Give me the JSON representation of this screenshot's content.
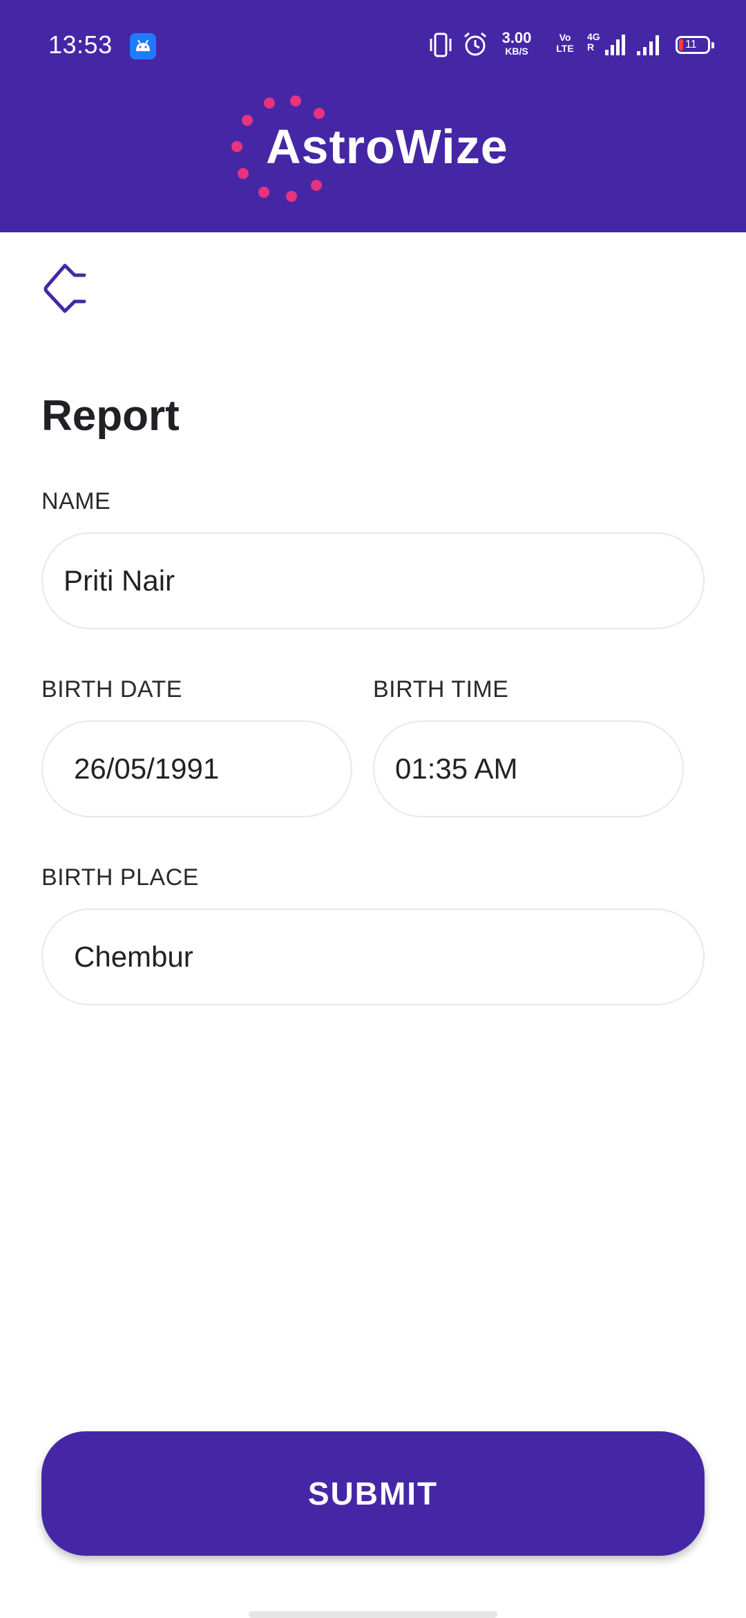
{
  "status_bar": {
    "time": "13:53",
    "speed_value": "3.00",
    "speed_unit": "KB/S",
    "volte_line1": "Vo",
    "volte_line2": "LTE",
    "network_line1": "4G",
    "network_line2": "R",
    "battery": "11"
  },
  "header": {
    "logo_text": "AstroWize",
    "color": "#4527a6",
    "logo_dots_color": "#e8337e"
  },
  "page": {
    "title": "Report"
  },
  "form": {
    "name_label": "NAME",
    "name_value": "Priti Nair",
    "birth_date_label": "BIRTH DATE",
    "birth_date_value": "26/05/1991",
    "birth_time_label": "BIRTH TIME",
    "birth_time_value": "01:35 AM",
    "birth_place_label": "BIRTH PLACE",
    "birth_place_value": "Chembur"
  },
  "submit": {
    "label": "SUBMIT"
  }
}
